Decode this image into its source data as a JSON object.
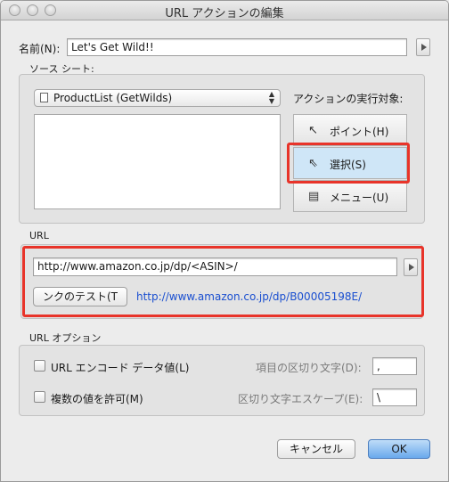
{
  "window": {
    "title": "URL アクションの編集"
  },
  "name_row": {
    "label": "名前(N):",
    "value": "Let's Get Wild!!"
  },
  "source": {
    "section_label": "ソース シート:",
    "sheet_popup": "ProductList (GetWilds)",
    "target_label": "アクションの実行対象:",
    "targets": [
      {
        "label": "ポイント(H)",
        "icon": "pointer-cursor-icon",
        "selected": false
      },
      {
        "label": "選択(S)",
        "icon": "select-cursor-icon",
        "selected": true
      },
      {
        "label": "メニュー(U)",
        "icon": "menu-cursor-icon",
        "selected": false
      }
    ]
  },
  "url": {
    "section_label": "URL",
    "value": "http://www.amazon.co.jp/dp/<ASIN>/",
    "test_button": "ンクのテスト(T",
    "test_result": "http://www.amazon.co.jp/dp/B000051​98E/"
  },
  "url_options": {
    "section_label": "URL オプション",
    "encode_label": "URL エンコード データ値(L)",
    "multi_label": "複数の値を許可(M)",
    "item_sep_label": "項目の区切り文字(D):",
    "item_sep_value": ",",
    "escape_label": "区切り文字エスケープ(E):",
    "escape_value": "\\"
  },
  "buttons": {
    "cancel": "キャンセル",
    "ok": "OK"
  },
  "colors": {
    "highlight": "#e8342a",
    "link": "#1a4fd0",
    "selected": "#cfe6f7"
  }
}
